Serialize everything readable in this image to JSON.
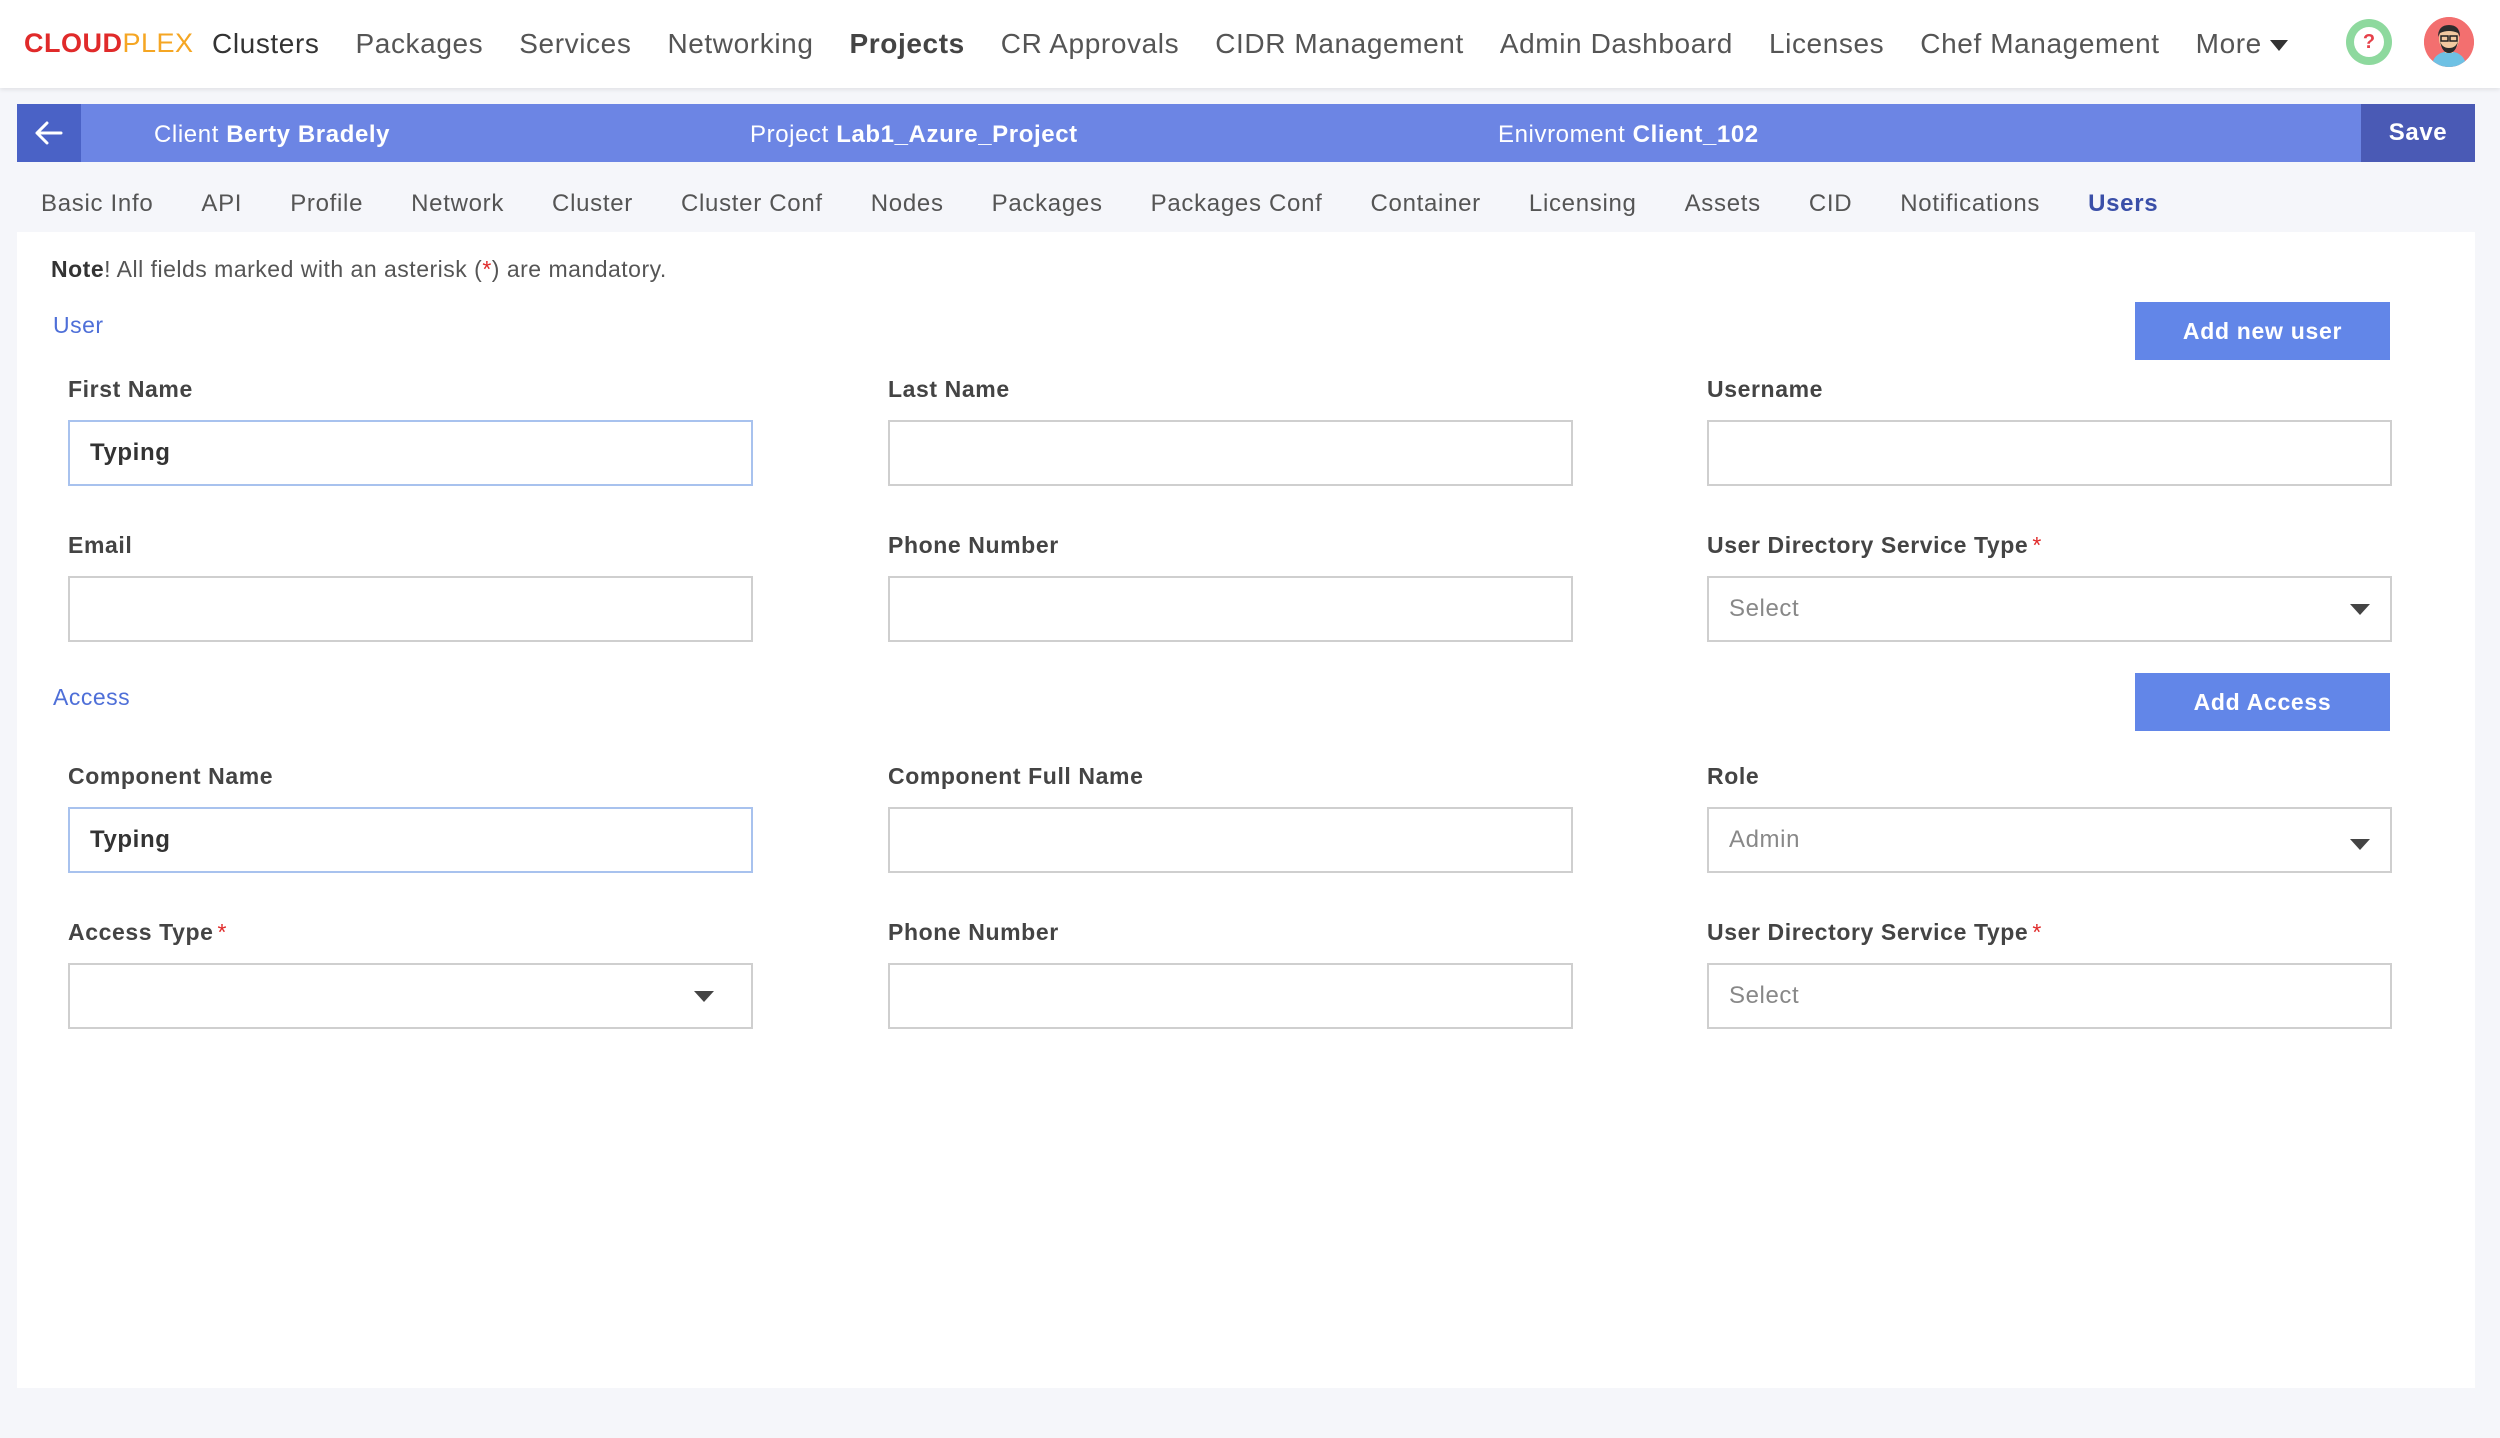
{
  "logo": {
    "cloud": "CLOUD",
    "plex": "PLEX"
  },
  "nav": {
    "items": [
      "Clusters",
      "Packages",
      "Services",
      "Networking",
      "Projects",
      "CR Approvals",
      "CIDR Management",
      "Admin Dashboard",
      "Licenses",
      "Chef Management"
    ],
    "more": "More",
    "help": "?"
  },
  "project_bar": {
    "client_label": "Client",
    "client_value": "Berty Bradely",
    "project_label": "Project",
    "project_value": "Lab1_Azure_Project",
    "env_label": "Enivroment",
    "env_value": "Client_102",
    "save": "Save"
  },
  "tabs": [
    "Basic Info",
    "API",
    "Profile",
    "Network",
    "Cluster",
    "Cluster Conf",
    "Nodes",
    "Packages",
    "Packages Conf",
    "Container",
    "Licensing",
    "Assets",
    "CID",
    "Notifications",
    "Users"
  ],
  "note": {
    "bold": "Note",
    "text_before": "! All fields marked with an asterisk (",
    "asterisk": "*",
    "text_after": ") are mandatory."
  },
  "user_section": {
    "title": "User",
    "add_button": "Add new user",
    "first_name": {
      "label": "First Name",
      "value": "Typing"
    },
    "last_name": {
      "label": "Last Name",
      "value": ""
    },
    "username": {
      "label": "Username",
      "value": ""
    },
    "email": {
      "label": "Email",
      "value": ""
    },
    "phone": {
      "label": "Phone Number",
      "value": ""
    },
    "uds_type": {
      "label": "User Directory Service Type",
      "asterisk": "*",
      "value": "Select"
    }
  },
  "access_section": {
    "title": "Access",
    "add_button": "Add Access",
    "component_name": {
      "label": "Component Name",
      "value": "Typing"
    },
    "component_full_name": {
      "label": "Component Full Name",
      "value": ""
    },
    "role": {
      "label": "Role",
      "value": "Admin"
    },
    "access_type": {
      "label": "Access Type",
      "asterisk": "*",
      "value": ""
    },
    "phone": {
      "label": "Phone Number",
      "value": ""
    },
    "uds_type": {
      "label": "User Directory Service Type",
      "asterisk": "*",
      "value": "Select"
    }
  }
}
